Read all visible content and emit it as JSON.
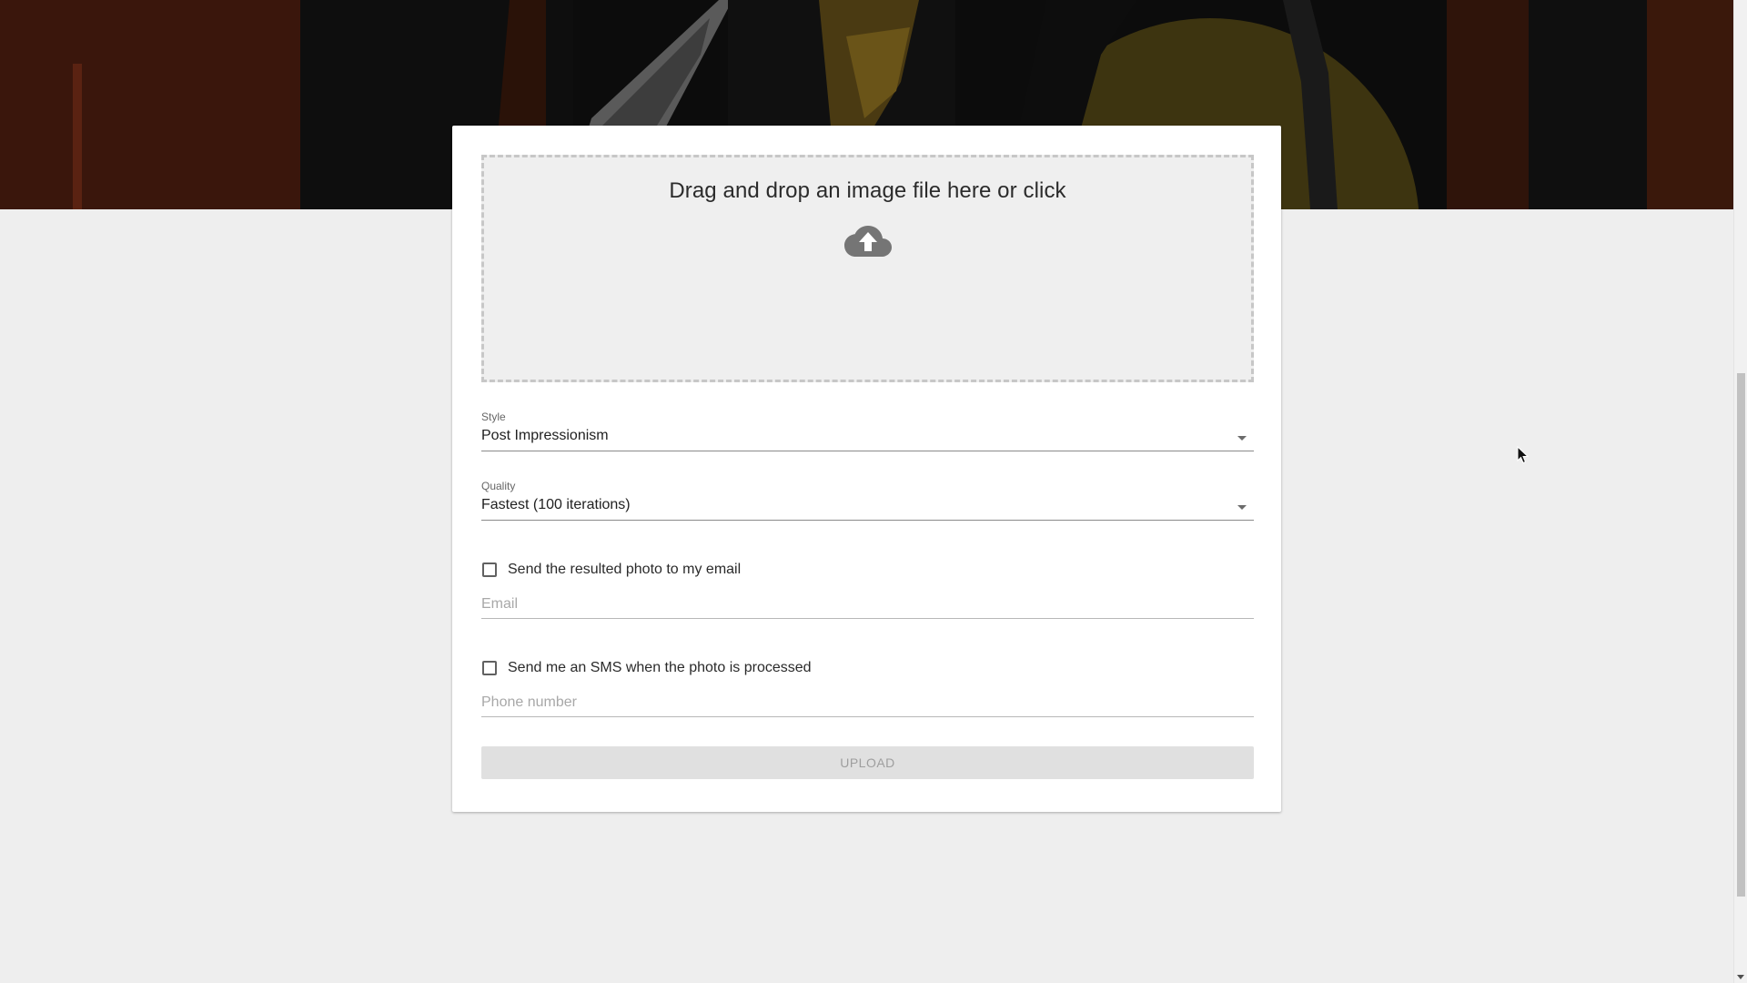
{
  "dropzone": {
    "text": "Drag and drop an image file here or click",
    "icon": "cloud-upload-icon"
  },
  "style_field": {
    "label": "Style",
    "value": "Post Impressionism"
  },
  "quality_field": {
    "label": "Quality",
    "value": "Fastest (100 iterations)"
  },
  "email_option": {
    "label": "Send the resulted photo to my email",
    "checked": false,
    "placeholder": "Email"
  },
  "sms_option": {
    "label": "Send me an SMS when the photo is processed",
    "checked": false,
    "placeholder": "Phone number"
  },
  "upload_button": {
    "label": "UPLOAD",
    "disabled": true
  },
  "colors": {
    "page_background": "#eeeeee",
    "card_background": "#ffffff",
    "dropzone_background": "#efefef",
    "button_disabled": "#e0e0e0"
  }
}
